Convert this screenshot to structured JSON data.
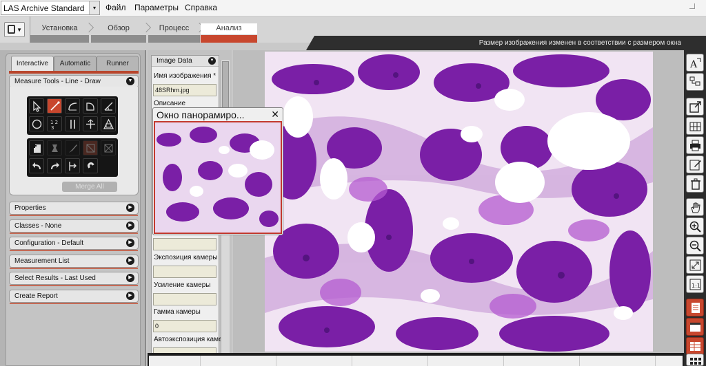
{
  "menubar": {
    "app_name": "LAS Archive Standard",
    "menu_file": "Файл",
    "menu_params": "Параметры",
    "menu_help": "Справка"
  },
  "workflow": {
    "steps": [
      "Установка",
      "Обзор",
      "Процесс",
      "Анализ"
    ],
    "active_step": "Анализ"
  },
  "status": {
    "message": "Размер изображения изменен в соответствии с размером окна"
  },
  "left_panel": {
    "tabs": [
      "Interactive",
      "Automatic",
      "Runner"
    ],
    "active_tab": "Interactive",
    "measure_tools_title": "Measure Tools - Line - Draw",
    "merge_all_label": "Merge All",
    "sections": [
      "Properties",
      "Classes - None",
      "Configuration - Default",
      "Measurement List",
      "Select Results - Last Used",
      "Create Report"
    ]
  },
  "image_data": {
    "header": "Image Data",
    "image_name_label": "Имя изображения",
    "required_mark": "*",
    "image_name_value": "48SRhm.jpg",
    "description_label": "Описание",
    "exposure_label": "Экспозиция камеры",
    "gain_label": "Усиление камеры",
    "gamma_label": "Гамма камеры",
    "gamma_value": "0",
    "autoexposure_label": "Автоэкспозиция каме"
  },
  "panorama": {
    "title": "Окно панорамиро..."
  },
  "colors": {
    "accent": "#c8472e",
    "stain_purple": "#7a1fa6",
    "stain_light": "#f3eaf5"
  },
  "icons": {
    "app_select_arrow": "▾",
    "tool_dropdown_arrow": "▼",
    "panel_expand": "▼",
    "panel_collapsed": "▶",
    "close": "✕"
  }
}
